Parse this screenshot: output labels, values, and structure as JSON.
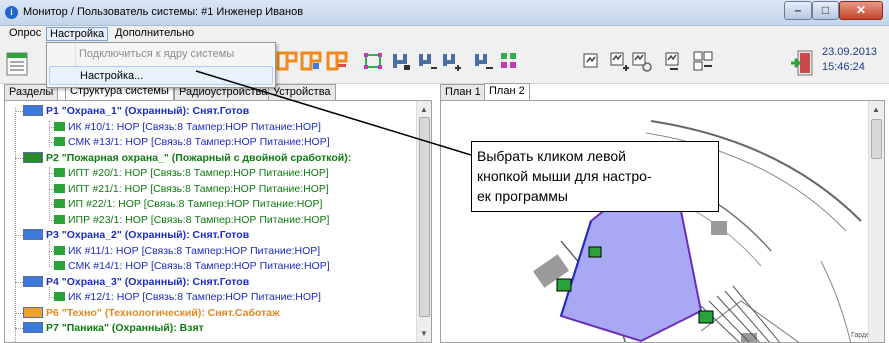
{
  "window": {
    "title": "Монитор / Пользователь системы: #1 Инженер Иванов",
    "app_icon": "info-circle-icon",
    "min_symbol": "–",
    "max_symbol": "□",
    "close_symbol": "✕"
  },
  "menubar": {
    "items": [
      "Опрос",
      "Настройка",
      "Дополнительно"
    ],
    "open_index": 1
  },
  "dropdown": {
    "items": [
      {
        "label": "Подключиться к ядру системы",
        "enabled": false
      },
      {
        "label": "Настройка...",
        "enabled": true,
        "hovered": true
      }
    ]
  },
  "toolbar": {
    "date": "23.09.2013",
    "time": "15:46:24"
  },
  "left_tabs": [
    "Разделы",
    "Структура системы",
    "Радиоустройства",
    "Устройства"
  ],
  "left_active_tab": 1,
  "right_tabs": [
    "План 1",
    "План 2"
  ],
  "right_active_tab": 1,
  "tree": [
    {
      "kind": "group",
      "cls": "",
      "text": "Р1 \"Охрана_1\" (Охранный): Снят.Готов"
    },
    {
      "kind": "sensor",
      "cls": "",
      "text": "ИК #10/1: НОР [Связь:8 Тампер:НОР Питание:НОР]"
    },
    {
      "kind": "sensor",
      "cls": "",
      "text": "СМК #13/1: НОР [Связь:8 Тампер:НОР Питание:НОР]"
    },
    {
      "kind": "group",
      "cls": "fire",
      "text": "Р2 \"Пожарная охрана_\" (Пожарный с двойной сработкой):"
    },
    {
      "kind": "sensor",
      "cls": "fire",
      "text": "ИПТ #20/1: НОР [Связь:8 Тампер:НОР Питание:НОР]"
    },
    {
      "kind": "sensor",
      "cls": "fire",
      "text": "ИПТ #21/1: НОР [Связь:8 Тампер:НОР Питание:НОР]"
    },
    {
      "kind": "sensor",
      "cls": "fire",
      "text": "ИП #22/1: НОР [Связь:8 Тампер:НОР Питание:НОР]"
    },
    {
      "kind": "sensor",
      "cls": "fire",
      "text": "ИПР #23/1: НОР [Связь:8 Тампер:НОР Питание:НОР]"
    },
    {
      "kind": "group",
      "cls": "",
      "text": "Р3 \"Охрана_2\" (Охранный): Снят.Готов"
    },
    {
      "kind": "sensor",
      "cls": "",
      "text": "ИК #11/1: НОР [Связь:8 Тампер:НОР Питание:НОР]"
    },
    {
      "kind": "sensor",
      "cls": "",
      "text": "СМК #14/1: НОР [Связь:8 Тампер:НОР Питание:НОР]"
    },
    {
      "kind": "group",
      "cls": "",
      "text": "Р4 \"Охрана_3\" (Охранный): Снят.Готов"
    },
    {
      "kind": "sensor",
      "cls": "",
      "text": "ИК #12/1: НОР [Связь:8 Тампер:НОР Питание:НОР]"
    },
    {
      "kind": "group",
      "cls": "tech",
      "text": "Р6 \"Техно\" (Технологический): Снят.Саботаж"
    },
    {
      "kind": "group",
      "cls": "alarm",
      "text": "Р7 \"Паника\" (Охранный): Взят"
    }
  ],
  "callout": {
    "lines": [
      "Выбрать кликом левой",
      "кнопкой мыши для настро-",
      "ек программы"
    ]
  },
  "plan": {
    "room_label": "Гардероб"
  },
  "colors": {
    "group_blue": "#1c2cc4",
    "fire_green": "#0e7a10",
    "tech_orange": "#e08a1e",
    "date_blue": "#1f3d8a",
    "room_fill": "#a8a8f4"
  }
}
